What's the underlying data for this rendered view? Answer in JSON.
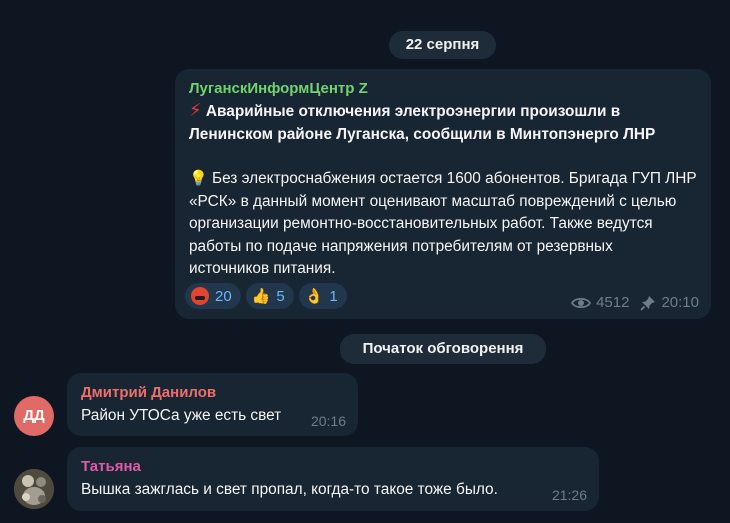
{
  "date_separator": "22 серпня",
  "post": {
    "channel": "ЛуганскИнформЦентр Z",
    "lightning_icon": "⚡",
    "title": "Аварийные отключения электроэнергии произошли в Ленинском районе Луганска, сообщили в Минтопэнерго ЛНР",
    "bulb_icon": "💡",
    "body": "Без электроснабжения остается 1600 абонентов. Бригада ГУП ЛНР «РСК» в данный момент оценивают масштаб повреждений с целью организации ремонтно-восстановительных работ. Также ведутся работы по подаче напряжения потребителям от резервных источников питания.",
    "reactions": [
      {
        "icon": "angry-face-icon",
        "count": "20"
      },
      {
        "icon": "thumbs-up-icon",
        "emoji": "👍",
        "count": "5"
      },
      {
        "icon": "ok-hand-icon",
        "emoji": "👌",
        "count": "1"
      }
    ],
    "views": "4512",
    "time": "20:10"
  },
  "discussion_separator": "Початок обговорення",
  "comments": [
    {
      "avatar_initials": "ДД",
      "author": "Дмитрий Данилов",
      "text": "Район УТОСа уже есть свет",
      "time": "20:16",
      "avatar_color": "#e06b66",
      "author_color": "#ee6f6a"
    },
    {
      "author": "Татьяна",
      "text": "Вышка зажглась и свет пропал, когда-то такое тоже было.",
      "time": "21:26",
      "author_color": "#e05aa7"
    }
  ]
}
